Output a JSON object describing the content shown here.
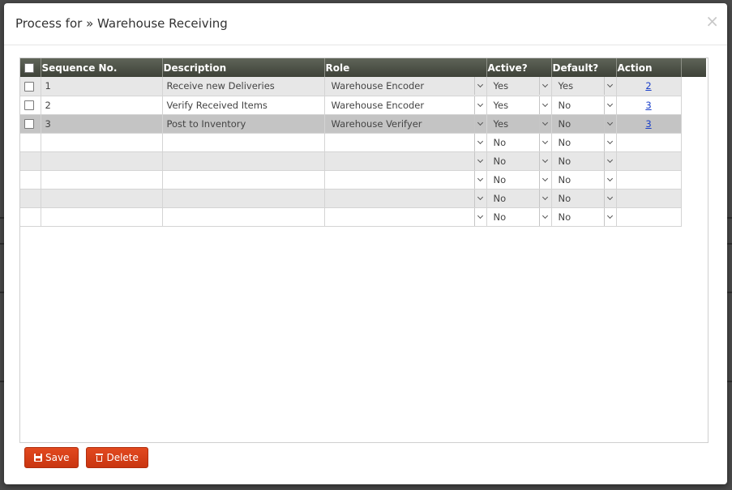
{
  "dialog": {
    "title": "Process for » Warehouse Receiving",
    "close_glyph": "×"
  },
  "grid": {
    "columns": {
      "sequence": "Sequence No.",
      "description": "Description",
      "role": "Role",
      "active": "Active?",
      "default": "Default?",
      "action": "Action"
    },
    "rows": [
      {
        "sequence": "1",
        "description": "Receive new Deliveries",
        "role": "Warehouse Encoder",
        "active": "Yes",
        "default": "Yes",
        "action": "2"
      },
      {
        "sequence": "2",
        "description": "Verify Received Items",
        "role": "Warehouse Encoder",
        "active": "Yes",
        "default": "No",
        "action": "3"
      },
      {
        "sequence": "3",
        "description": "Post to Inventory",
        "role": "Warehouse Verifyer",
        "active": "Yes",
        "default": "No",
        "action": "3"
      },
      {
        "sequence": "",
        "description": "",
        "role": "",
        "active": "No",
        "default": "No",
        "action": ""
      },
      {
        "sequence": "",
        "description": "",
        "role": "",
        "active": "No",
        "default": "No",
        "action": ""
      },
      {
        "sequence": "",
        "description": "",
        "role": "",
        "active": "No",
        "default": "No",
        "action": ""
      },
      {
        "sequence": "",
        "description": "",
        "role": "",
        "active": "No",
        "default": "No",
        "action": ""
      },
      {
        "sequence": "",
        "description": "",
        "role": "",
        "active": "No",
        "default": "No",
        "action": ""
      }
    ]
  },
  "footer": {
    "save_label": "Save",
    "delete_label": "Delete"
  },
  "colors": {
    "header_bg": "#4b5045",
    "accent_button": "#d63e15",
    "link": "#1a3fc9"
  }
}
